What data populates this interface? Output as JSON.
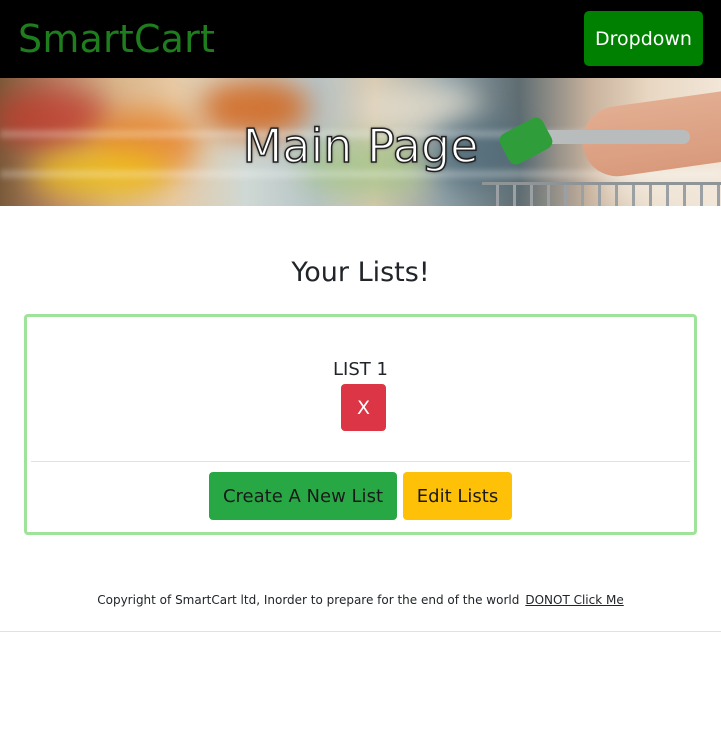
{
  "navbar": {
    "brand": "SmartCart",
    "dropdown_label": "Dropdown"
  },
  "hero": {
    "title": "Main Page"
  },
  "main": {
    "heading": "Your Lists!",
    "lists": [
      {
        "name": "LIST 1",
        "delete_label": "X"
      }
    ],
    "create_label": "Create A New List",
    "edit_label": "Edit Lists"
  },
  "footer": {
    "text": "Copyright of SmartCart ltd, Inorder to prepare for the end of the world",
    "link_label": "DONOT Click Me"
  },
  "colors": {
    "navbar_bg": "#000000",
    "brand": "#1e7e1e",
    "dropdown_bg": "#008000",
    "card_border": "#9fe29a",
    "delete": "#dc3545",
    "create": "#28a745",
    "edit": "#ffc107"
  }
}
